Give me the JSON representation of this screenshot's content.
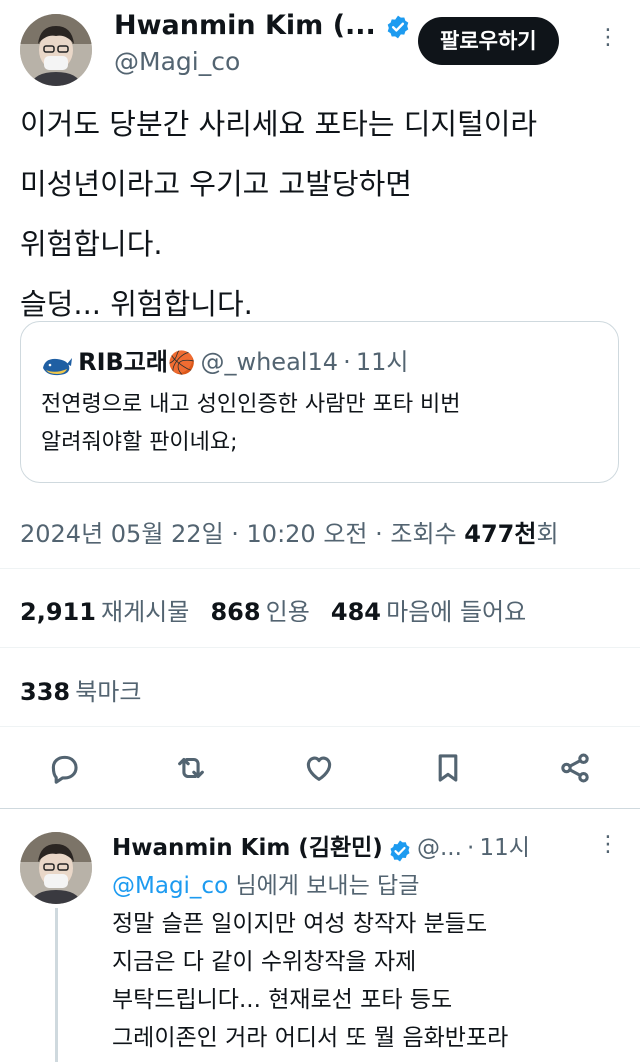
{
  "tweet": {
    "author_name": "Hwanmin Kim (...",
    "author_handle": "@Magi_co",
    "follow_label": "팔로우하기",
    "more_glyph": "⋮",
    "lines": [
      "이거도 당분간 사리세요 포타는 디지털이라",
      "미성년이라고 우기고 고발당하면",
      "위험합니다.",
      "슬덩... 위험합니다."
    ],
    "quote": {
      "name": "RIB고래",
      "emoji": "🏀",
      "handle": "@_wheal14",
      "sep": "·",
      "time": "11시",
      "lines": [
        "전연령으로 내고 성인인증한 사람만 포타 비번",
        "알려줘야할 판이네요;"
      ]
    },
    "timestamp": "2024년 05월 22일 · 10:20 오전 · 조회수",
    "views_value": "477천",
    "views_unit": "회",
    "stats": {
      "reposts_num": "2,911",
      "reposts_label": "재게시물",
      "quotes_num": "868",
      "quotes_label": "인용",
      "likes_num": "484",
      "likes_label": "마음에 들어요",
      "bookmarks_num": "338",
      "bookmarks_label": "북마크"
    }
  },
  "reply": {
    "author_name": "Hwanmin Kim (김환민)",
    "handle": "@...",
    "sep": "·",
    "time": "11시",
    "more_glyph": "⋮",
    "reply_to_handle": "@Magi_co",
    "reply_to_suffix": " 님에게 보내는 답글",
    "lines": [
      "정말 슬픈 일이지만 여성 창작자 분들도",
      "지금은 다 같이 수위창작을 자제",
      "부탁드립니다... 현재로선 포타 등도",
      "그레이존인 거라 어디서 또 뭘 음화반포라"
    ]
  },
  "colors": {
    "text": "#0f1419",
    "secondary": "#536471",
    "accent": "#1d9bf0",
    "border": "#cfd9de"
  },
  "icons": [
    "verified-badge-icon",
    "reply-icon",
    "repost-icon",
    "like-icon",
    "bookmark-icon",
    "share-icon",
    "whale-icon",
    "basketball-icon"
  ]
}
